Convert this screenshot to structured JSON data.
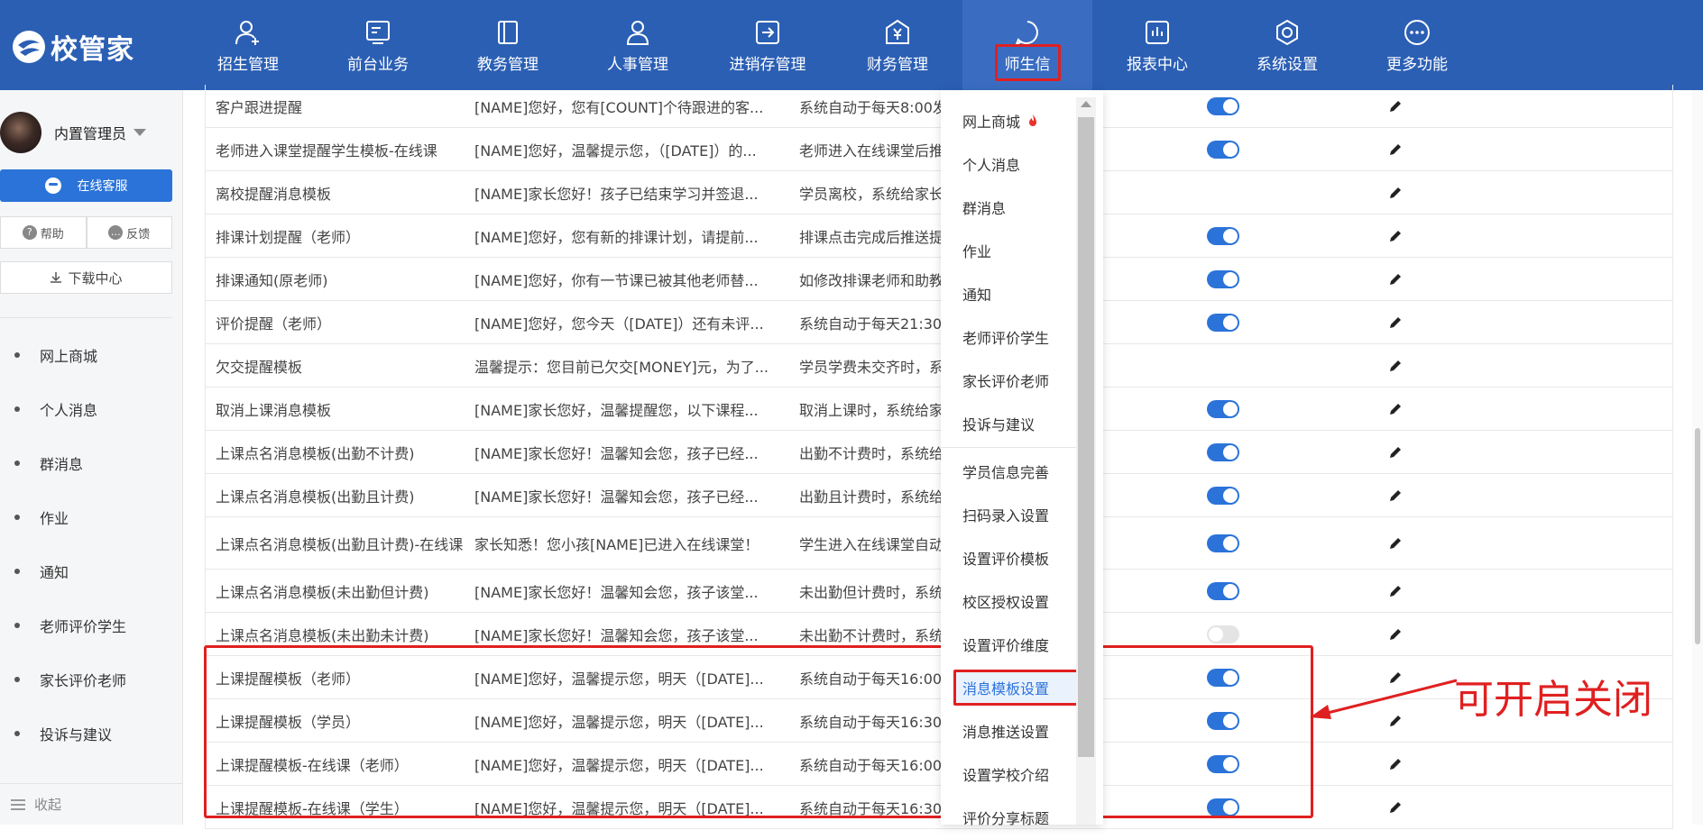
{
  "app": {
    "logo_text": "校管家"
  },
  "nav": [
    {
      "label": "招生管理",
      "icon": "user-plus-icon"
    },
    {
      "label": "前台业务",
      "icon": "reception-icon"
    },
    {
      "label": "教务管理",
      "icon": "book-icon"
    },
    {
      "label": "人事管理",
      "icon": "person-icon"
    },
    {
      "label": "进销存管理",
      "icon": "inventory-icon"
    },
    {
      "label": "财务管理",
      "icon": "finance-icon"
    },
    {
      "label": "师生信",
      "icon": "chat-icon",
      "active": true
    },
    {
      "label": "报表中心",
      "icon": "report-icon"
    },
    {
      "label": "系统设置",
      "icon": "settings-icon"
    },
    {
      "label": "更多功能",
      "icon": "more-icon"
    }
  ],
  "sidebar": {
    "user_name": "内置管理员",
    "service_label": "在线客服",
    "help_label": "帮助",
    "feedback_label": "反馈",
    "download_label": "下载中心",
    "collapse_label": "收起",
    "items": [
      "网上商城",
      "个人消息",
      "群消息",
      "作业",
      "通知",
      "老师评价学生",
      "家长评价老师",
      "投诉与建议"
    ]
  },
  "table": {
    "rows": [
      {
        "name": "客户跟进提醒",
        "content": "[NAME]您好，您有[COUNT]个待跟进的客...",
        "desc": "系统自动于每天8:00发",
        "toggle": "on"
      },
      {
        "name": "老师进入课堂提醒学生模板-在线课",
        "content": "[NAME]您好，温馨提示您，（[DATE]）的...",
        "desc": "老师进入在线课堂后推",
        "toggle": "on"
      },
      {
        "name": "离校提醒消息模板",
        "content": "[NAME]家长您好！孩子已结束学习并签退...",
        "desc": "学员离校，系统给家长",
        "toggle": "none"
      },
      {
        "name": "排课计划提醒（老师）",
        "content": "[NAME]您好，您有新的排课计划，请提前...",
        "desc": "排课点击完成后推送提",
        "toggle": "on"
      },
      {
        "name": "排课通知(原老师)",
        "content": "[NAME]您好，你有一节课已被其他老师替...",
        "desc": "如修改排课老师和助教",
        "toggle": "on"
      },
      {
        "name": "评价提醒（老师）",
        "content": "[NAME]您好，您今天（[DATE]）还有未评...",
        "desc": "系统自动于每天21:30",
        "toggle": "on"
      },
      {
        "name": "欠交提醒模板",
        "content": "温馨提示：您目前已欠交[MONEY]元，为了...",
        "desc": "学员学费未交齐时，系",
        "toggle": "none"
      },
      {
        "name": "取消上课消息模板",
        "content": "[NAME]家长您好，温馨提醒您，以下课程...",
        "desc": "取消上课时，系统给家",
        "toggle": "on"
      },
      {
        "name": "上课点名消息模板(出勤不计费)",
        "content": "[NAME]家长您好！温馨知会您，孩子已经...",
        "desc": "出勤不计费时，系统给",
        "toggle": "on"
      },
      {
        "name": "上课点名消息模板(出勤且计费)",
        "content": "[NAME]家长您好！温馨知会您，孩子已经...",
        "desc": "出勤且计费时，系统给",
        "toggle": "on"
      },
      {
        "name": "上课点名消息模板(出勤且计费)-在线课",
        "content": "家长知悉！您小孩[NAME]已进入在线课堂！",
        "desc": "学生进入在线课堂自动",
        "toggle": "on",
        "tall": true
      },
      {
        "name": "上课点名消息模板(未出勤但计费)",
        "content": "[NAME]家长您好！温馨知会您，孩子该堂...",
        "desc": "未出勤但计费时，系统",
        "toggle": "on"
      },
      {
        "name": "上课点名消息模板(未出勤未计费)",
        "content": "[NAME]家长您好！温馨知会您，孩子该堂...",
        "desc": "未出勤不计费时，系统",
        "toggle": "off"
      },
      {
        "name": "上课提醒模板（老师）",
        "content": "[NAME]您好，温馨提示您，明天（[DATE]...",
        "desc": "系统自动于每天16:00",
        "toggle": "on"
      },
      {
        "name": "上课提醒模板（学员）",
        "content": "[NAME]您好，温馨提示您，明天（[DATE]...",
        "desc": "系统自动于每天16:30",
        "toggle": "on"
      },
      {
        "name": "上课提醒模板-在线课（老师）",
        "content": "[NAME]您好，温馨提示您，明天（[DATE]...",
        "desc": "系统自动于每天16:00",
        "toggle": "on"
      },
      {
        "name": "上课提醒模板-在线课（学生）",
        "content": "[NAME]您好，温馨提示您，明天（[DATE]...",
        "desc": "系统自动于每天16:30",
        "toggle": "on"
      }
    ]
  },
  "dropdown": {
    "group1": [
      "网上商城",
      "个人消息",
      "群消息",
      "作业",
      "通知",
      "老师评价学生",
      "家长评价老师",
      "投诉与建议"
    ],
    "group2": [
      "学员信息完善",
      "扫码录入设置",
      "设置评价模板",
      "校区授权设置",
      "设置评价维度",
      "消息模板设置",
      "消息推送设置",
      "设置学校介绍",
      "评价分享标题"
    ],
    "active": "消息模板设置"
  },
  "annotation": {
    "text": "可开启关闭",
    "color": "#e02020"
  },
  "colors": {
    "topbar": "#2b5fb4",
    "accent": "#2b73d9",
    "highlight": "#e02020"
  }
}
